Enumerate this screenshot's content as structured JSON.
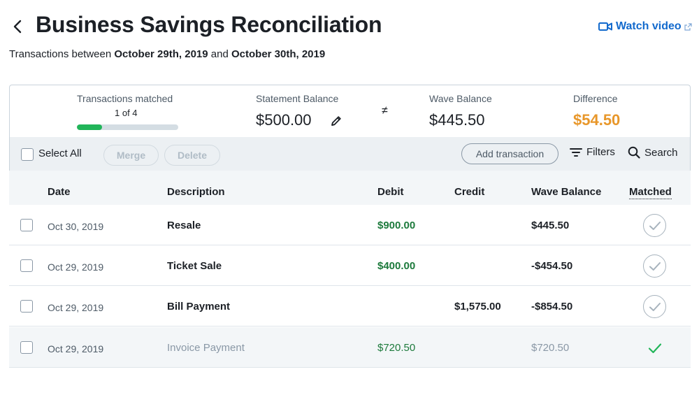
{
  "header": {
    "title": "Business Savings Reconciliation",
    "watch_video_label": "Watch video",
    "subtitle_prefix": "Transactions between",
    "subtitle_start": "October 29th, 2019",
    "subtitle_and": "and",
    "subtitle_end": "October 30th, 2019"
  },
  "summary": {
    "matched_label": "Transactions matched",
    "matched_count": "1 of 4",
    "matched_fraction": 0.25,
    "statement_label": "Statement Balance",
    "statement_value": "$500.00",
    "not_equal": "≠",
    "wave_label": "Wave Balance",
    "wave_value": "$445.50",
    "difference_label": "Difference",
    "difference_value": "$54.50"
  },
  "toolbar": {
    "select_all": "Select All",
    "merge": "Merge",
    "delete": "Delete",
    "add_transaction": "Add transaction",
    "filters": "Filters",
    "search": "Search"
  },
  "table": {
    "headers": {
      "date": "Date",
      "description": "Description",
      "debit": "Debit",
      "credit": "Credit",
      "wave_balance": "Wave Balance",
      "matched": "Matched"
    },
    "rows": [
      {
        "date": "Oct 30, 2019",
        "description": "Resale",
        "debit": "$900.00",
        "credit": "",
        "balance": "$445.50",
        "matched": false
      },
      {
        "date": "Oct 29, 2019",
        "description": "Ticket Sale",
        "debit": "$400.00",
        "credit": "",
        "balance": "-$454.50",
        "matched": false
      },
      {
        "date": "Oct 29, 2019",
        "description": "Bill Payment",
        "debit": "",
        "credit": "$1,575.00",
        "balance": "-$854.50",
        "matched": false
      },
      {
        "date": "Oct 29, 2019",
        "description": "Invoice Payment",
        "debit": "$720.50",
        "credit": "",
        "balance": "$720.50",
        "matched": true
      }
    ]
  },
  "colors": {
    "link": "#136acd",
    "difference": "#e8972a",
    "debit": "#1d7a3c",
    "progress": "#21b559",
    "match_done": "#21b559"
  },
  "icons": {
    "back": "chevron-left-icon",
    "video": "video-camera-icon",
    "external": "external-link-icon",
    "edit": "pencil-icon",
    "filters": "filter-lines-icon",
    "search": "magnifier-icon",
    "match": "check-icon"
  }
}
